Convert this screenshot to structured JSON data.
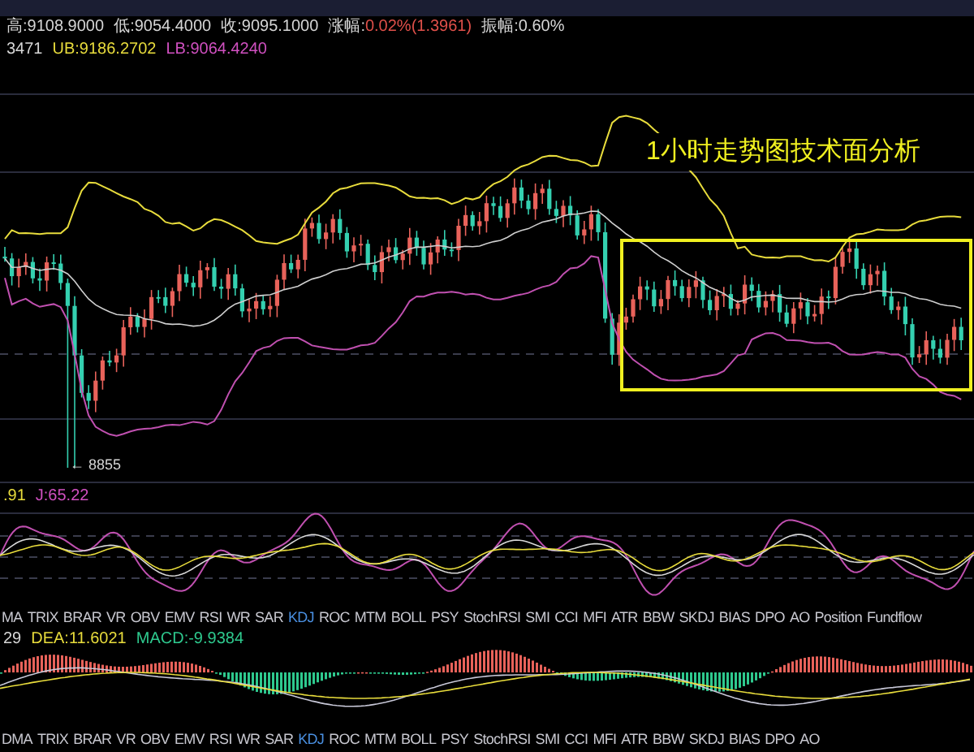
{
  "stats": [
    {
      "label": "高:",
      "value": "9108.9000",
      "color": "#d6d6d6"
    },
    {
      "label": "低:",
      "value": "9054.4000",
      "color": "#d6d6d6"
    },
    {
      "label": "收:",
      "value": "9095.1000",
      "color": "#d6d6d6"
    },
    {
      "label": "涨幅:",
      "value": "0.02%(1.3961)",
      "color": "#e0504a"
    },
    {
      "label": "振幅:",
      "value": "0.60%",
      "color": "#d6d6d6"
    }
  ],
  "boll_legend": [
    {
      "text": "3471",
      "color": "#d6d6d6"
    },
    {
      "text": "UB:9186.2702",
      "color": "#e8dc3c"
    },
    {
      "text": "LB:9064.4240",
      "color": "#d050c0"
    }
  ],
  "annotation": "1小时走势图技术面分析",
  "low_marker": "← 8855",
  "kdj_legend": [
    {
      "text": ".91",
      "color": "#e8dc3c"
    },
    {
      "text": "J:65.22",
      "color": "#d050c0"
    }
  ],
  "indicator_tabs": [
    {
      "label": "MA",
      "selected": false
    },
    {
      "label": "TRIX",
      "selected": false
    },
    {
      "label": "BRAR",
      "selected": false
    },
    {
      "label": "VR",
      "selected": false
    },
    {
      "label": "OBV",
      "selected": false
    },
    {
      "label": "EMV",
      "selected": false
    },
    {
      "label": "RSI",
      "selected": false
    },
    {
      "label": "WR",
      "selected": false
    },
    {
      "label": "SAR",
      "selected": false
    },
    {
      "label": "KDJ",
      "selected": true
    },
    {
      "label": "ROC",
      "selected": false
    },
    {
      "label": "MTM",
      "selected": false
    },
    {
      "label": "BOLL",
      "selected": false
    },
    {
      "label": "PSY",
      "selected": false
    },
    {
      "label": "StochRSI",
      "selected": false
    },
    {
      "label": "SMI",
      "selected": false
    },
    {
      "label": "CCI",
      "selected": false
    },
    {
      "label": "MFI",
      "selected": false
    },
    {
      "label": "ATR",
      "selected": false
    },
    {
      "label": "BBW",
      "selected": false
    },
    {
      "label": "SKDJ",
      "selected": false
    },
    {
      "label": "BIAS",
      "selected": false
    },
    {
      "label": "DPO",
      "selected": false
    },
    {
      "label": "AO",
      "selected": false
    },
    {
      "label": "Position",
      "selected": false
    },
    {
      "label": "Fundflow",
      "selected": false
    }
  ],
  "macd_legend": [
    {
      "text": "29",
      "color": "#d6d6d6"
    },
    {
      "text": "DEA:11.6021",
      "color": "#e8dc3c"
    },
    {
      "text": "MACD:-9.9384",
      "color": "#2ec98e"
    }
  ],
  "indicator_tabs_2": [
    {
      "label": "DMA",
      "selected": false
    },
    {
      "label": "TRIX",
      "selected": false
    },
    {
      "label": "BRAR",
      "selected": false
    },
    {
      "label": "VR",
      "selected": false
    },
    {
      "label": "OBV",
      "selected": false
    },
    {
      "label": "EMV",
      "selected": false
    },
    {
      "label": "RSI",
      "selected": false
    },
    {
      "label": "WR",
      "selected": false
    },
    {
      "label": "SAR",
      "selected": false
    },
    {
      "label": "KDJ",
      "selected": true
    },
    {
      "label": "ROC",
      "selected": false
    },
    {
      "label": "MTM",
      "selected": false
    },
    {
      "label": "BOLL",
      "selected": false
    },
    {
      "label": "PSY",
      "selected": false
    },
    {
      "label": "StochRSI",
      "selected": false
    },
    {
      "label": "SMI",
      "selected": false
    },
    {
      "label": "CCI",
      "selected": false
    },
    {
      "label": "MFI",
      "selected": false
    },
    {
      "label": "ATR",
      "selected": false
    },
    {
      "label": "BBW",
      "selected": false
    },
    {
      "label": "SKDJ",
      "selected": false
    },
    {
      "label": "BIAS",
      "selected": false
    },
    {
      "label": "DPO",
      "selected": false
    },
    {
      "label": "AO",
      "selected": false
    }
  ]
}
